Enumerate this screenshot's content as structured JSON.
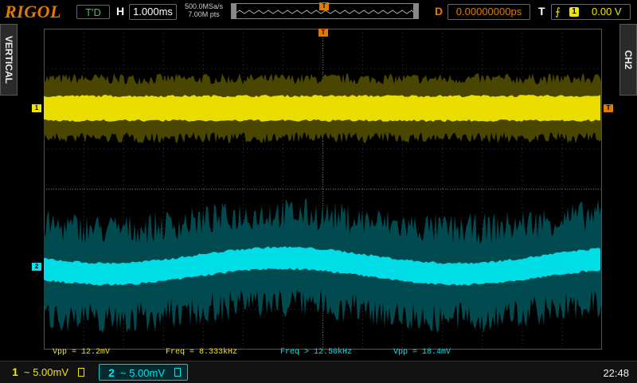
{
  "header": {
    "logo": "RIGOL",
    "run_state": "T'D",
    "horizontal_label": "H",
    "timebase": "1.000ms",
    "sample_rate": "500.0MSa/s",
    "memory_depth": "7.00M pts",
    "delay_label": "D",
    "delay_value": "0.00000000ps",
    "trigger_label": "T",
    "trigger_source": "1",
    "trigger_level": "0.00 V",
    "trigger_position_marker": "T"
  },
  "side_tabs": {
    "left": "VERTICAL",
    "right": "CH2"
  },
  "channel_markers": {
    "ch1": "1",
    "ch2": "2",
    "trigger": "T"
  },
  "measurements": [
    {
      "label": "Vpp = 12.2mV",
      "color": "#f2e600"
    },
    {
      "label": "Freq = 8.333kHz",
      "color": "#f2e600"
    },
    {
      "label": "Freq > 12.50kHz",
      "color": "#00e5ee"
    },
    {
      "label": "Vpp = 18.4mV",
      "color": "#00e5ee"
    }
  ],
  "footer": {
    "ch1": {
      "number": "1",
      "scale": "~ 5.00mV",
      "color": "#f2e600"
    },
    "ch2": {
      "number": "2",
      "scale": "~ 5.00mV",
      "color": "#00e5ee",
      "selected": true
    },
    "time": "22:48"
  },
  "colors": {
    "ch1": "#f2e600",
    "ch2": "#00e5ee",
    "accent": "#e07a00",
    "grid": "#3a3a3a"
  },
  "icons": {
    "trigger_edge": "rising-edge-icon",
    "bandwidth": "bandwidth-limit-icon"
  }
}
